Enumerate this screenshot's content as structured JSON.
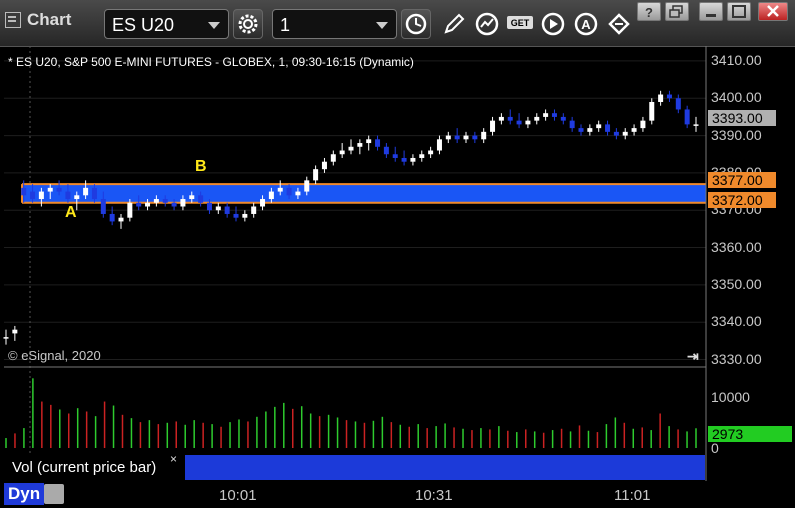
{
  "window": {
    "title": "Chart",
    "symbol": "ES U20",
    "interval": "1"
  },
  "legend": "* ES U20, S&P 500 E-MINI FUTURES - GLOBEX, 1, 09:30-16:15 (Dynamic)",
  "copyright": "© eSignal, 2020",
  "price_axis": [
    "3410.00",
    "3400.00",
    "3390.00",
    "3380.00",
    "3370.00",
    "3360.00",
    "3350.00",
    "3340.00",
    "3330.00"
  ],
  "price_tags": {
    "last": "3393.00",
    "upper": "3377.00",
    "lower": "3372.00"
  },
  "volume_axis": {
    "top": "10000",
    "bottom": "0",
    "last": "2973"
  },
  "annotations": {
    "a": "A",
    "b": "B"
  },
  "study_label": "Vol (current price bar)",
  "study_close": "×",
  "footer": {
    "mode": "Dyn",
    "times": [
      "10:01",
      "10:31",
      "11:01"
    ]
  },
  "colors": {
    "up_bar": "#ffffff",
    "down_bar": "#1f3be0",
    "zone_fill": "#1a56f5",
    "zone_line": "#f08a2c",
    "vol_up": "#2ecc2e",
    "vol_down": "#cc2222",
    "last_tag": "#b0b0b0",
    "level_tag": "#f08a2c",
    "vol_tag": "#22cc22"
  },
  "chart_data": {
    "type": "candlestick",
    "y_range": [
      3328,
      3414
    ],
    "upper_level": 3377,
    "lower_level": 3372,
    "bars": [
      [
        3336,
        3338,
        3334,
        3336
      ],
      [
        3337,
        3339,
        3335,
        3338
      ],
      [
        3376,
        3378,
        3372,
        3374
      ],
      [
        3375,
        3377,
        3372,
        3373
      ],
      [
        3373,
        3376,
        3371,
        3375
      ],
      [
        3375,
        3377,
        3373,
        3376
      ],
      [
        3376,
        3378,
        3374,
        3375
      ],
      [
        3375,
        3377,
        3372,
        3373
      ],
      [
        3373,
        3375,
        3370,
        3374
      ],
      [
        3374,
        3378,
        3373,
        3376
      ],
      [
        3376,
        3377,
        3372,
        3373
      ],
      [
        3373,
        3375,
        3368,
        3369
      ],
      [
        3369,
        3371,
        3366,
        3367
      ],
      [
        3367,
        3369,
        3365,
        3368
      ],
      [
        3368,
        3373,
        3367,
        3372
      ],
      [
        3372,
        3374,
        3370,
        3371
      ],
      [
        3371,
        3373,
        3370,
        3372
      ],
      [
        3372,
        3374,
        3371,
        3373
      ],
      [
        3373,
        3374,
        3371,
        3372
      ],
      [
        3372,
        3373,
        3370,
        3371
      ],
      [
        3371,
        3374,
        3370,
        3373
      ],
      [
        3373,
        3375,
        3372,
        3374
      ],
      [
        3374,
        3375,
        3371,
        3372
      ],
      [
        3372,
        3373,
        3369,
        3370
      ],
      [
        3370,
        3372,
        3369,
        3371
      ],
      [
        3371,
        3372,
        3368,
        3369
      ],
      [
        3369,
        3371,
        3367,
        3368
      ],
      [
        3368,
        3370,
        3367,
        3369
      ],
      [
        3369,
        3372,
        3368,
        3371
      ],
      [
        3371,
        3374,
        3370,
        3373
      ],
      [
        3373,
        3376,
        3372,
        3375
      ],
      [
        3375,
        3378,
        3374,
        3376
      ],
      [
        3376,
        3377,
        3373,
        3374
      ],
      [
        3374,
        3376,
        3373,
        3375
      ],
      [
        3375,
        3379,
        3374,
        3378
      ],
      [
        3378,
        3382,
        3377,
        3381
      ],
      [
        3381,
        3384,
        3380,
        3383
      ],
      [
        3383,
        3386,
        3382,
        3385
      ],
      [
        3385,
        3388,
        3384,
        3386
      ],
      [
        3386,
        3389,
        3385,
        3387
      ],
      [
        3387,
        3389,
        3385,
        3388
      ],
      [
        3388,
        3390,
        3386,
        3389
      ],
      [
        3389,
        3390,
        3386,
        3387
      ],
      [
        3387,
        3388,
        3384,
        3385
      ],
      [
        3385,
        3387,
        3383,
        3384
      ],
      [
        3384,
        3386,
        3382,
        3383
      ],
      [
        3383,
        3385,
        3382,
        3384
      ],
      [
        3384,
        3386,
        3383,
        3385
      ],
      [
        3385,
        3387,
        3384,
        3386
      ],
      [
        3386,
        3390,
        3385,
        3389
      ],
      [
        3389,
        3391,
        3388,
        3390
      ],
      [
        3390,
        3392,
        3388,
        3389
      ],
      [
        3389,
        3391,
        3388,
        3390
      ],
      [
        3390,
        3391,
        3388,
        3389
      ],
      [
        3389,
        3392,
        3388,
        3391
      ],
      [
        3391,
        3395,
        3390,
        3394
      ],
      [
        3394,
        3396,
        3393,
        3395
      ],
      [
        3395,
        3397,
        3393,
        3394
      ],
      [
        3394,
        3396,
        3392,
        3393
      ],
      [
        3393,
        3395,
        3392,
        3394
      ],
      [
        3394,
        3396,
        3393,
        3395
      ],
      [
        3395,
        3397,
        3394,
        3396
      ],
      [
        3396,
        3397,
        3394,
        3395
      ],
      [
        3395,
        3396,
        3393,
        3394
      ],
      [
        3394,
        3395,
        3391,
        3392
      ],
      [
        3392,
        3393,
        3390,
        3391
      ],
      [
        3391,
        3393,
        3390,
        3392
      ],
      [
        3392,
        3394,
        3391,
        3393
      ],
      [
        3393,
        3394,
        3390,
        3391
      ],
      [
        3391,
        3392,
        3389,
        3390
      ],
      [
        3390,
        3392,
        3389,
        3391
      ],
      [
        3391,
        3393,
        3390,
        3392
      ],
      [
        3392,
        3395,
        3391,
        3394
      ],
      [
        3394,
        3400,
        3393,
        3399
      ],
      [
        3399,
        3402,
        3398,
        3401
      ],
      [
        3401,
        3402,
        3399,
        3400
      ],
      [
        3400,
        3401,
        3396,
        3397
      ],
      [
        3397,
        3398,
        3392,
        3393
      ],
      [
        3393,
        3395,
        3391,
        3393
      ]
    ],
    "volume": [
      [
        1500,
        "up"
      ],
      [
        2200,
        "down"
      ],
      [
        3000,
        "up"
      ],
      [
        10500,
        "up"
      ],
      [
        7000,
        "down"
      ],
      [
        6500,
        "down"
      ],
      [
        5800,
        "up"
      ],
      [
        5200,
        "down"
      ],
      [
        6000,
        "up"
      ],
      [
        5500,
        "down"
      ],
      [
        4800,
        "up"
      ],
      [
        7000,
        "down"
      ],
      [
        6400,
        "up"
      ],
      [
        5000,
        "down"
      ],
      [
        4500,
        "up"
      ],
      [
        3900,
        "down"
      ],
      [
        4200,
        "up"
      ],
      [
        3600,
        "down"
      ],
      [
        3800,
        "up"
      ],
      [
        4000,
        "down"
      ],
      [
        3500,
        "up"
      ],
      [
        4200,
        "up"
      ],
      [
        3800,
        "down"
      ],
      [
        3600,
        "up"
      ],
      [
        3200,
        "down"
      ],
      [
        3900,
        "up"
      ],
      [
        4300,
        "up"
      ],
      [
        4000,
        "down"
      ],
      [
        4700,
        "up"
      ],
      [
        5500,
        "up"
      ],
      [
        6200,
        "up"
      ],
      [
        6800,
        "up"
      ],
      [
        5900,
        "down"
      ],
      [
        6300,
        "up"
      ],
      [
        5200,
        "up"
      ],
      [
        4800,
        "down"
      ],
      [
        5000,
        "up"
      ],
      [
        4600,
        "up"
      ],
      [
        4200,
        "down"
      ],
      [
        4000,
        "up"
      ],
      [
        3800,
        "down"
      ],
      [
        4100,
        "up"
      ],
      [
        4700,
        "up"
      ],
      [
        3900,
        "down"
      ],
      [
        3500,
        "up"
      ],
      [
        3200,
        "down"
      ],
      [
        3600,
        "up"
      ],
      [
        3000,
        "down"
      ],
      [
        3300,
        "up"
      ],
      [
        3700,
        "up"
      ],
      [
        3100,
        "down"
      ],
      [
        2900,
        "up"
      ],
      [
        2700,
        "down"
      ],
      [
        3000,
        "up"
      ],
      [
        2800,
        "down"
      ],
      [
        3300,
        "up"
      ],
      [
        2600,
        "down"
      ],
      [
        2400,
        "up"
      ],
      [
        2800,
        "down"
      ],
      [
        2500,
        "up"
      ],
      [
        2300,
        "down"
      ],
      [
        2700,
        "up"
      ],
      [
        2900,
        "down"
      ],
      [
        2500,
        "up"
      ],
      [
        3400,
        "down"
      ],
      [
        2600,
        "up"
      ],
      [
        2400,
        "down"
      ],
      [
        3600,
        "up"
      ],
      [
        4600,
        "up"
      ],
      [
        3800,
        "down"
      ],
      [
        2900,
        "up"
      ],
      [
        3100,
        "down"
      ],
      [
        2700,
        "up"
      ],
      [
        5200,
        "down"
      ],
      [
        3300,
        "up"
      ],
      [
        2800,
        "down"
      ],
      [
        2500,
        "up"
      ],
      [
        2973,
        "up"
      ]
    ]
  }
}
